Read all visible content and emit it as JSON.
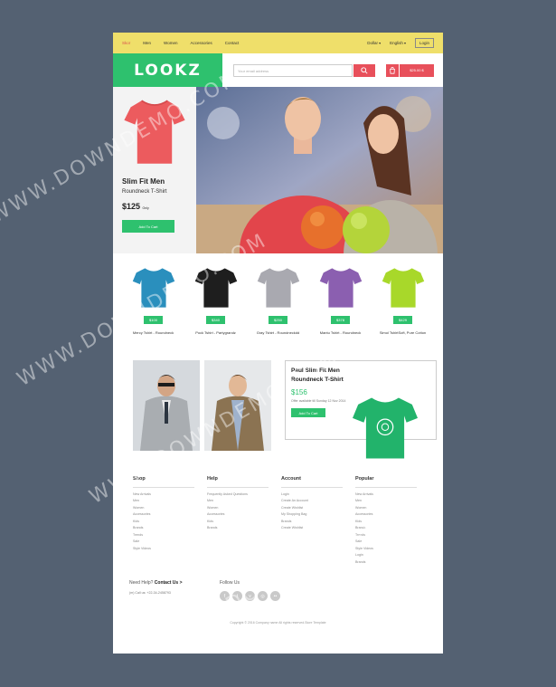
{
  "topnav": {
    "links": [
      "Skor",
      "Men",
      "Women",
      "Accessories",
      "Contact"
    ],
    "dollar": "Dollar",
    "language": "English",
    "login": "Login"
  },
  "header": {
    "logo": "LOOKZ",
    "search_placeholder": "Your email address",
    "cart_total": "$25.00 $"
  },
  "hero": {
    "title": "Slim Fit Men",
    "subtitle": "Roundneck T-Shirt",
    "price": "$125",
    "price_unit": "Only",
    "button": "Add To Cart"
  },
  "products": [
    {
      "price": "$100",
      "name": "Mercy Tshirt - Roundneck",
      "color": "#2a8fbd"
    },
    {
      "price": "$340",
      "name": "Pock Tshirt - Partygrandz",
      "color": "#1e1e1e"
    },
    {
      "price": "$250",
      "name": "Gray Tshirt - Roundneckdd",
      "color": "#a9a9b0"
    },
    {
      "price": "$378",
      "name": "Mantu Tshirt - Roundneck",
      "color": "#8b5fb0"
    },
    {
      "price": "$429",
      "name": "Simol TshirtSoft, Pure Cotton",
      "color": "#a8d82a"
    }
  ],
  "feature": {
    "title_line1": "Paul Slim Fit Men",
    "title_line2": "Roundneck T-Shirt",
    "price": "$156",
    "note": "Offer available till Sunday 12 Nov 2014",
    "button": "Add To Cart"
  },
  "footer": {
    "columns": [
      {
        "title": "Shop",
        "items": [
          "New Arrivals",
          "Men",
          "Women",
          "Accessories",
          "Kids",
          "Brands",
          "Trends",
          "Sale",
          "Style Videos"
        ]
      },
      {
        "title": "Help",
        "items": [
          "Frequently Asked Questions",
          "Men",
          "Women",
          "Accessories",
          "Kids",
          "Brands"
        ]
      },
      {
        "title": "Account",
        "items": [
          "Login",
          "Create An Account",
          "Create Wishlist",
          "My Shopping Bag",
          "Brands",
          "Create Wishlist"
        ]
      },
      {
        "title": "Popular",
        "items": [
          "New Arrivals",
          "Men",
          "Women",
          "Accessories",
          "Kids",
          "Brands",
          "Trends",
          "Sale",
          "Style Videos",
          "Login",
          "Brands"
        ]
      }
    ],
    "need_help": "Need Help?",
    "contact_us": "Contact Us >",
    "call": "(m) Call us: +22-34-2458793",
    "follow": "Follow Us",
    "copyright": "Copyright © 2016 Company name All rights reserved.Store Template"
  },
  "watermark": "WWW.DOWNDEMO.COM",
  "colors": {
    "accent": "#2ec16e",
    "red": "#e8505b",
    "yellow": "#efdf6a"
  }
}
